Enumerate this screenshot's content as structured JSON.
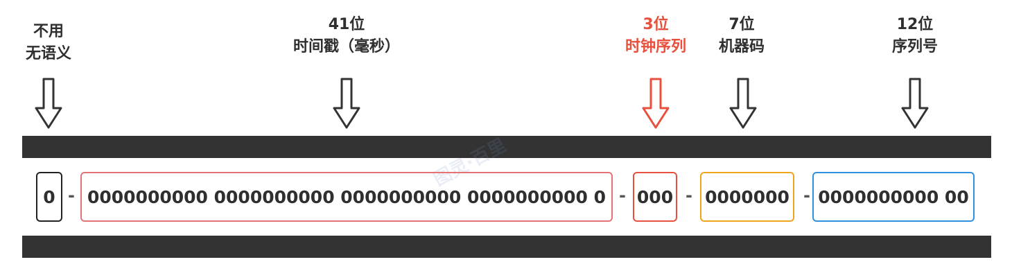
{
  "fields": [
    {
      "bits": "",
      "name": "不用\n无语义",
      "value": "0",
      "color": "#222222"
    },
    {
      "bits": "41位",
      "name": "时间戳（毫秒）",
      "value": "0000000000 0000000000 0000000000 0000000000 0",
      "color": "#e57373"
    },
    {
      "bits": "3位",
      "name": "时钟序列",
      "value": "000",
      "color": "#e8503e"
    },
    {
      "bits": "7位",
      "name": "机器码",
      "value": "0000000",
      "color": "#f0a31c"
    },
    {
      "bits": "12位",
      "name": "序列号",
      "value": "0000000000 00",
      "color": "#2f8fe0"
    }
  ],
  "separator": "-",
  "watermark": "图灵·百里"
}
